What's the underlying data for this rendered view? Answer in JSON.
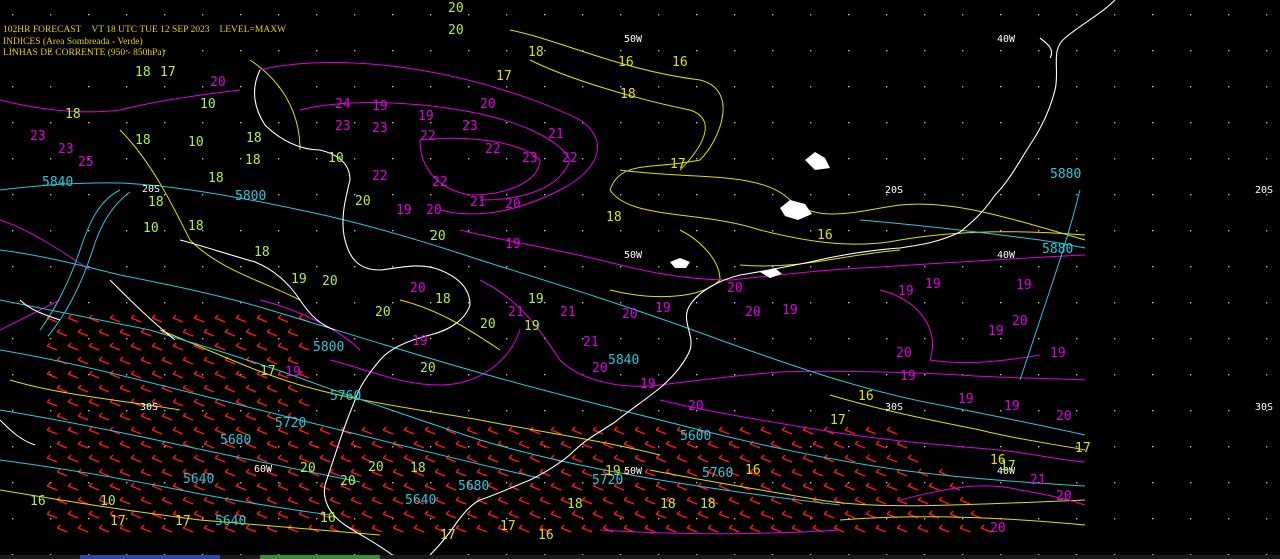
{
  "header": {
    "forecast": "102HR FORECAST",
    "valid": "VT 18 UTC TUE 12 SEP 2023",
    "level": "LEVEL=MAXW",
    "indices": "INDICES (Area Sombreada - Verde)",
    "streamlines": "LINHAS DE CORRENTE (950 - 850hPa)"
  },
  "colors": {
    "background": "#000000",
    "coast": "#ffffff",
    "thickness_contours": "#28c8d8",
    "index_contours": "#e000e0",
    "yellow_contours": "#e0e000",
    "green_labels": "#b0f040",
    "wind_barbs": "#ff1a1a",
    "header_text": "#e8d000"
  },
  "graticule": {
    "longitudes": [
      "50W",
      "40W",
      "50W",
      "40W",
      "60W",
      "50W",
      "40W"
    ],
    "latitudes": [
      "20S",
      "20S",
      "20S",
      "30S",
      "30S",
      "30S"
    ]
  },
  "thickness_labels": [
    "5840",
    "5880",
    "5880",
    "5800",
    "5840",
    "5760",
    "5720",
    "5680",
    "5720",
    "5760",
    "5680",
    "5640",
    "5640",
    "5640",
    "5600",
    "5800"
  ],
  "magenta_labels": [
    "20",
    "24",
    "20",
    "19",
    "19",
    "23",
    "23",
    "22",
    "23",
    "22",
    "21",
    "23",
    "22",
    "23",
    "23",
    "25",
    "22",
    "22",
    "21",
    "19",
    "20",
    "20",
    "19",
    "20",
    "21",
    "21",
    "20",
    "19",
    "20",
    "19",
    "21",
    "19",
    "20",
    "20",
    "19",
    "19",
    "20",
    "19",
    "19",
    "19",
    "19",
    "19",
    "20",
    "20",
    "19",
    "19",
    "21",
    "20",
    "20",
    "20",
    "19"
  ],
  "yellow_labels": [
    "16",
    "17",
    "18",
    "18",
    "17",
    "16",
    "16",
    "18",
    "19",
    "16",
    "17",
    "16",
    "17",
    "16",
    "17",
    "17",
    "16",
    "17",
    "17"
  ],
  "green_labels": [
    "18",
    "18",
    "17",
    "10",
    "10",
    "18",
    "20",
    "20",
    "18",
    "10",
    "18",
    "18",
    "18",
    "18",
    "10",
    "20",
    "20",
    "19",
    "18",
    "18",
    "19",
    "20",
    "20",
    "20",
    "19",
    "20",
    "18",
    "20",
    "20",
    "20",
    "18",
    "16",
    "18",
    "18",
    "10",
    "16",
    "17",
    "17"
  ]
}
